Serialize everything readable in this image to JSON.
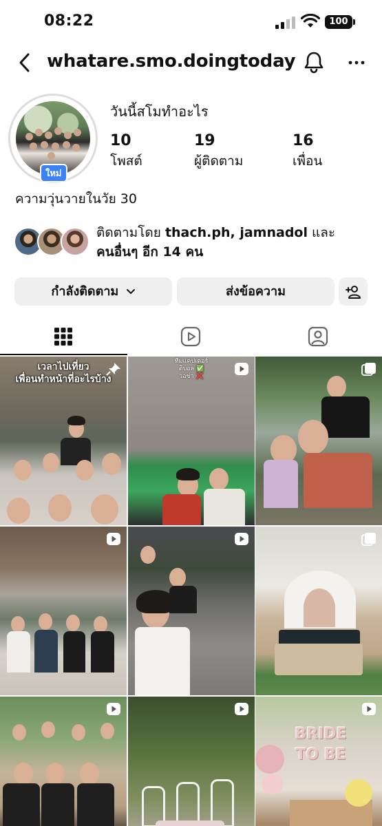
{
  "status_bar": {
    "time": "08:22",
    "battery": "100",
    "icons": [
      "signal-icon",
      "wifi-icon",
      "battery-icon"
    ]
  },
  "header": {
    "username": "whatare.smo.doingtoday",
    "icons": [
      "back-arrow-icon",
      "bell-icon",
      "more-icon"
    ]
  },
  "profile": {
    "display_name": "วันนี้สโมทำอะไร",
    "new_badge": "ใหม่",
    "stats": [
      {
        "value": "10",
        "label": "โพสต์"
      },
      {
        "value": "19",
        "label": "ผู้ติดตาม"
      },
      {
        "value": "16",
        "label": "เพื่อน"
      }
    ],
    "bio": "ความวุ่นวายในวัย 30",
    "followed_by": {
      "prefix": "ติดตามโดย",
      "names": "thach.ph, jamnadol",
      "and": "และ",
      "others": "คนอื่นๆ อีก 14 คน"
    }
  },
  "actions": {
    "following_label": "กำลังติดตาม",
    "message_label": "ส่งข้อความ",
    "add_user_icon": "add-user-icon"
  },
  "tabs": [
    {
      "name": "grid",
      "icon": "grid-icon",
      "active": true
    },
    {
      "name": "reels",
      "icon": "reels-icon",
      "active": false
    },
    {
      "name": "tagged",
      "icon": "tagged-icon",
      "active": false
    }
  ],
  "posts": [
    {
      "type": "pinned",
      "overlay": "เวลาไปเที่ยว\nเพื่อนทำหน้าที่อะไรบ้าง"
    },
    {
      "type": "reel",
      "overlay": "ทีมแคปเตอร์\nดิบอล ✅\nวอซ่า ❌"
    },
    {
      "type": "carousel",
      "overlay": ""
    },
    {
      "type": "reel",
      "overlay": ""
    },
    {
      "type": "reel",
      "overlay": ""
    },
    {
      "type": "carousel",
      "overlay": ""
    },
    {
      "type": "reel",
      "overlay": ""
    },
    {
      "type": "reel",
      "overlay": ""
    },
    {
      "type": "reel",
      "overlay": "BRIDE TO BE"
    }
  ],
  "colors": {
    "accent_blue": "#3b82f6",
    "button_bg": "#efefef",
    "text": "#111111"
  }
}
